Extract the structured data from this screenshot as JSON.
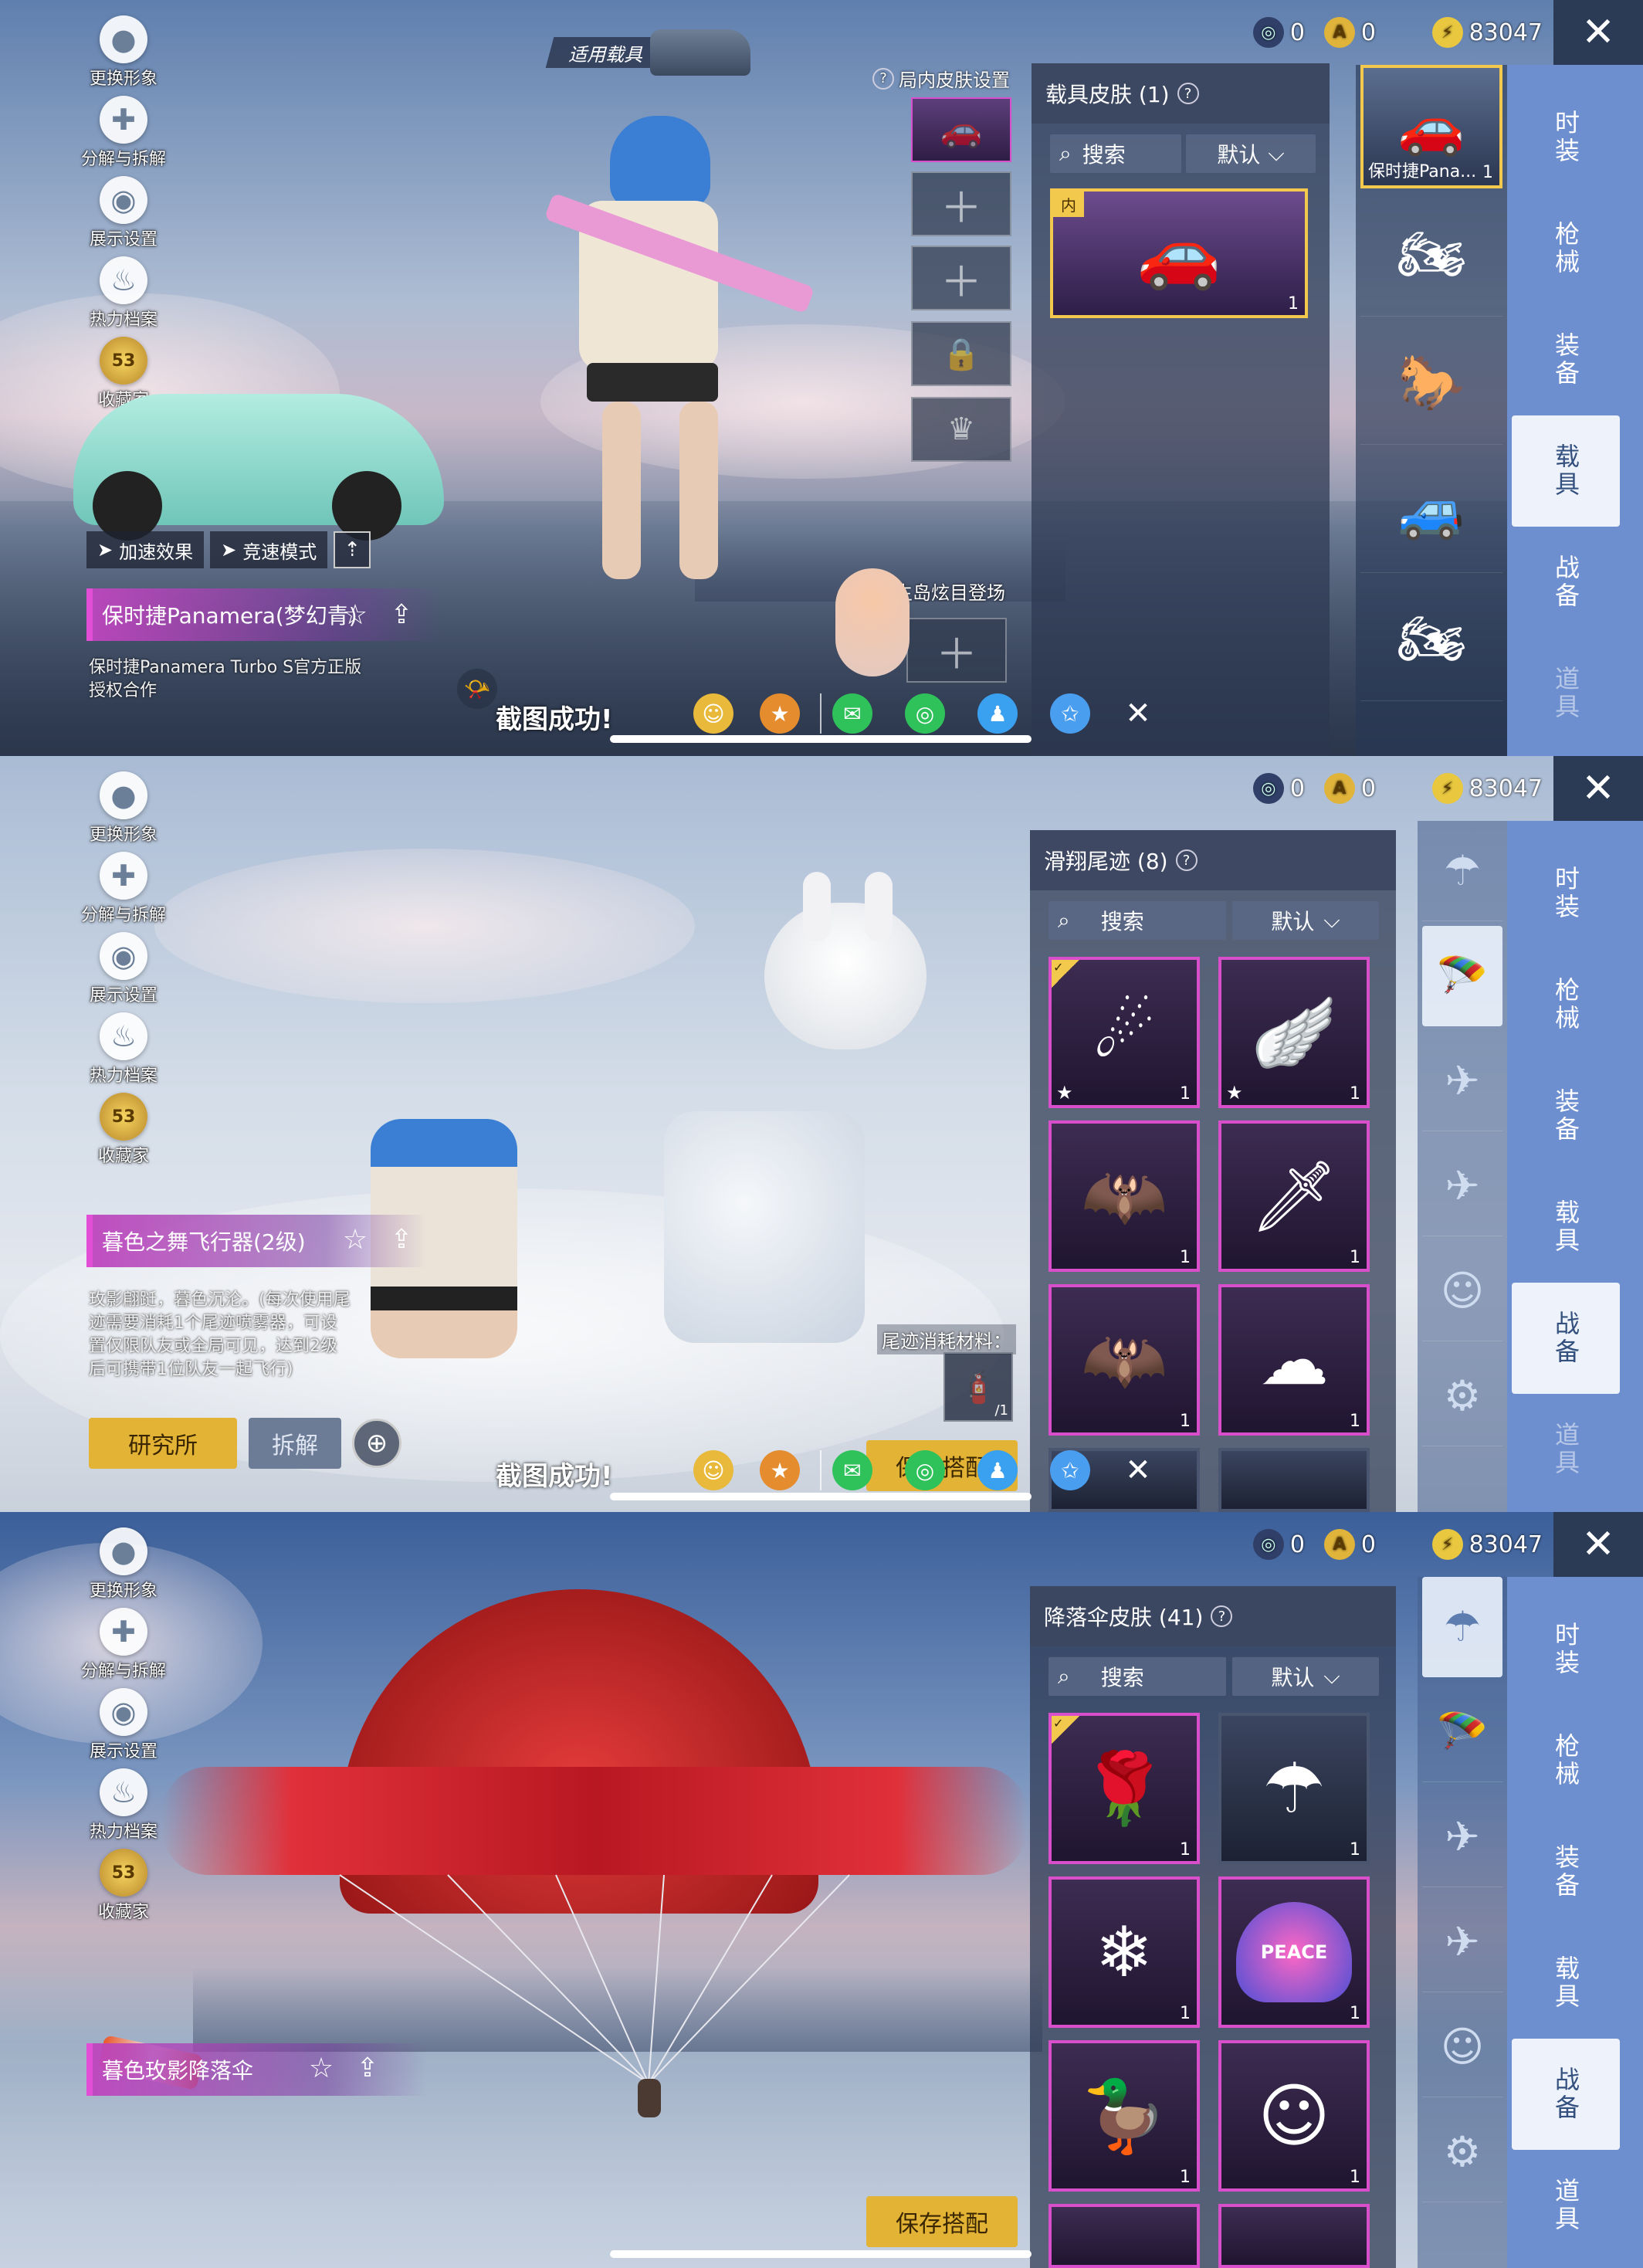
{
  "currency": {
    "silver": "0",
    "gold": "0",
    "bp": "83047"
  },
  "left_menu": [
    {
      "label": "更换形象",
      "icon": "avatar-icon"
    },
    {
      "label": "分解与拆解",
      "icon": "puzzle-icon"
    },
    {
      "label": "展示设置",
      "icon": "eye-icon"
    },
    {
      "label": "热力档案",
      "icon": "flame-icon"
    },
    {
      "label": "收藏家",
      "icon": "collector-badge-icon",
      "badge": "53"
    }
  ],
  "categories": [
    "时装",
    "枪械",
    "装备",
    "载具",
    "战备",
    "道具"
  ],
  "screen1": {
    "applicable_vehicle": "适用载具",
    "in_game_skin_settings": "局内皮肤设置",
    "panel_title": "载具皮肤 (1)",
    "search": "搜索",
    "sort": "默认",
    "tile_tag": "内",
    "tile_count": "1",
    "selected_vehicle_label": "保时捷Pana...",
    "selected_vehicle_count": "1",
    "speed_effect": "加速效果",
    "race_mode": "竞速模式",
    "item_name": "保时捷Panamera(梦幻青)",
    "item_desc": "保时捷Panamera Turbo S官方正版授权合作",
    "spawn_entrance": "出生岛炫目登场",
    "screenshot_ok": "截图成功!"
  },
  "screen2": {
    "panel_title": "滑翔尾迹 (8)",
    "search": "搜索",
    "sort": "默认",
    "item_name": "暮色之舞飞行器(2级)",
    "item_desc": "玫影翩跹，暮色沉沦。(每次使用尾迹需要消耗1个尾迹喷雾器，可设置仅限队友或全局可见，达到2级后可携带1位队友一起飞行)",
    "trail_material": "尾迹消耗材料：",
    "material_count": "/1",
    "research_button": "研究所",
    "dismantle_button": "拆解",
    "save_button": "保存搭配",
    "screenshot_ok": "截图成功!",
    "tiles": [
      "1",
      "1",
      "1",
      "1",
      "1",
      "1"
    ]
  },
  "screen3": {
    "panel_title": "降落伞皮肤 (41)",
    "search": "搜索",
    "sort": "默认",
    "item_name": "暮色玫影降落伞",
    "save_button": "保存搭配",
    "tiles": [
      "1",
      "1",
      "1",
      "1",
      "1",
      "1"
    ],
    "peace_text": "PEACE"
  }
}
